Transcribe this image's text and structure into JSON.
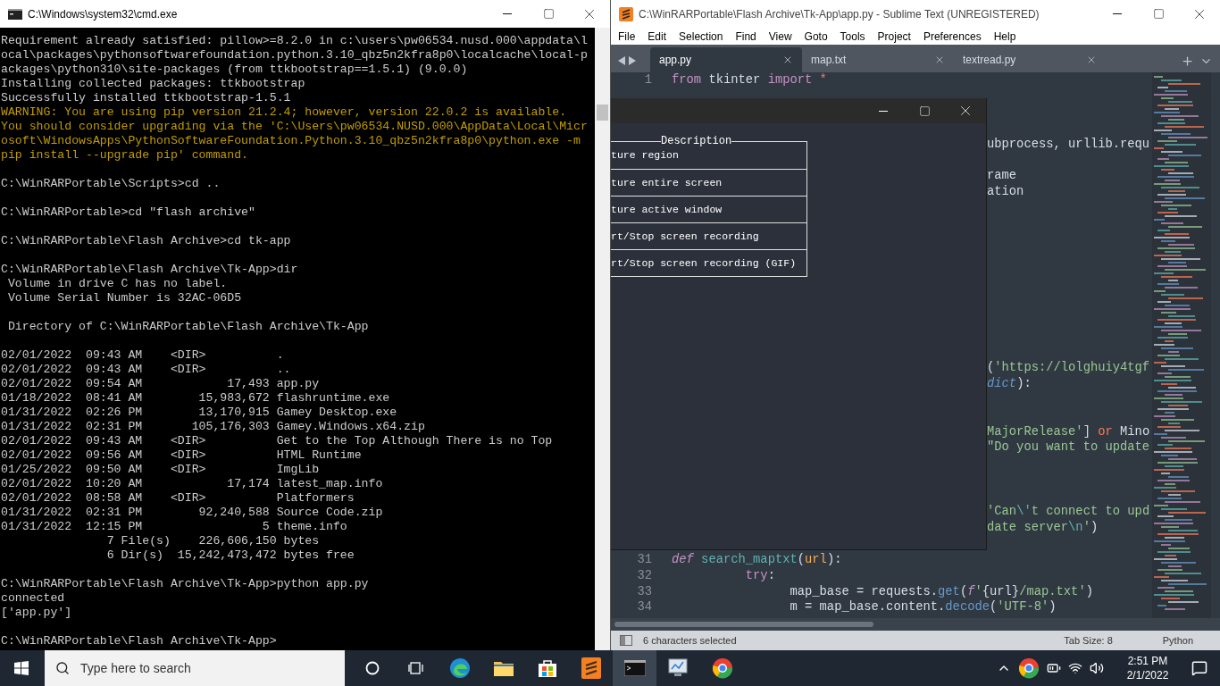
{
  "cmd_window": {
    "title": "C:\\Windows\\system32\\cmd.exe",
    "lines": [
      {
        "kind": "normal",
        "text": "Requirement already satisfied: pillow>=8.2.0 in c:\\users\\pw06534.nusd.000\\appdata\\l"
      },
      {
        "kind": "normal",
        "text": "ocal\\packages\\pythonsoftwarefoundation.python.3.10_qbz5n2kfra8p0\\localcache\\local-p"
      },
      {
        "kind": "normal",
        "text": "ackages\\python310\\site-packages (from ttkbootstrap==1.5.1) (9.0.0)"
      },
      {
        "kind": "normal",
        "text": "Installing collected packages: ttkbootstrap"
      },
      {
        "kind": "normal",
        "text": "Successfully installed ttkbootstrap-1.5.1"
      },
      {
        "kind": "warning",
        "text": "WARNING: You are using pip version 21.2.4; however, version 22.0.2 is available."
      },
      {
        "kind": "warning",
        "text": "You should consider upgrading via the 'C:\\Users\\pw06534.NUSD.000\\AppData\\Local\\Micr"
      },
      {
        "kind": "warning",
        "text": "osoft\\WindowsApps\\PythonSoftwareFoundation.Python.3.10_qbz5n2kfra8p0\\python.exe -m"
      },
      {
        "kind": "warning",
        "text": "pip install --upgrade pip' command."
      },
      {
        "kind": "blank"
      },
      {
        "kind": "normal",
        "text": "C:\\WinRARPortable\\Scripts>cd .."
      },
      {
        "kind": "blank"
      },
      {
        "kind": "normal",
        "text": "C:\\WinRARPortable>cd \"flash archive\""
      },
      {
        "kind": "blank"
      },
      {
        "kind": "normal",
        "text": "C:\\WinRARPortable\\Flash Archive>cd tk-app"
      },
      {
        "kind": "blank"
      },
      {
        "kind": "normal",
        "text": "C:\\WinRARPortable\\Flash Archive\\Tk-App>dir"
      },
      {
        "kind": "normal",
        "text": " Volume in drive C has no label."
      },
      {
        "kind": "normal",
        "text": " Volume Serial Number is 32AC-06D5"
      },
      {
        "kind": "blank"
      },
      {
        "kind": "normal",
        "text": " Directory of C:\\WinRARPortable\\Flash Archive\\Tk-App"
      },
      {
        "kind": "blank"
      },
      {
        "kind": "normal",
        "text": "02/01/2022  09:43 AM    <DIR>          ."
      },
      {
        "kind": "normal",
        "text": "02/01/2022  09:43 AM    <DIR>          .."
      },
      {
        "kind": "normal",
        "text": "02/01/2022  09:54 AM            17,493 app.py"
      },
      {
        "kind": "normal",
        "text": "01/18/2022  08:41 AM        15,983,672 flashruntime.exe"
      },
      {
        "kind": "normal",
        "text": "01/31/2022  02:26 PM        13,170,915 Gamey Desktop.exe"
      },
      {
        "kind": "normal",
        "text": "01/31/2022  02:31 PM       105,176,303 Gamey.Windows.x64.zip"
      },
      {
        "kind": "normal",
        "text": "02/01/2022  09:43 AM    <DIR>          Get to the Top Although There is no Top"
      },
      {
        "kind": "normal",
        "text": "02/01/2022  09:56 AM    <DIR>          HTML Runtime"
      },
      {
        "kind": "normal",
        "text": "01/25/2022  09:50 AM    <DIR>          ImgLib"
      },
      {
        "kind": "normal",
        "text": "02/01/2022  10:20 AM            17,174 latest_map.info"
      },
      {
        "kind": "normal",
        "text": "02/01/2022  08:58 AM    <DIR>          Platformers"
      },
      {
        "kind": "normal",
        "text": "01/31/2022  02:31 PM        92,240,588 Source Code.zip"
      },
      {
        "kind": "normal",
        "text": "01/31/2022  12:15 PM                 5 theme.info"
      },
      {
        "kind": "normal",
        "text": "               7 File(s)    226,606,150 bytes"
      },
      {
        "kind": "normal",
        "text": "               6 Dir(s)  15,242,473,472 bytes free"
      },
      {
        "kind": "blank"
      },
      {
        "kind": "normal",
        "text": "C:\\WinRARPortable\\Flash Archive\\Tk-App>python app.py"
      },
      {
        "kind": "normal",
        "text": "connected"
      },
      {
        "kind": "normal",
        "text": "['app.py']"
      },
      {
        "kind": "blank"
      },
      {
        "kind": "normal",
        "text": "C:\\WinRARPortable\\Flash Archive\\Tk-App>"
      }
    ]
  },
  "sublime_window": {
    "title": "C:\\WinRARPortable\\Flash Archive\\Tk-App\\app.py - Sublime Text (UNREGISTERED)",
    "menu": [
      "File",
      "Edit",
      "Selection",
      "Find",
      "View",
      "Goto",
      "Tools",
      "Project",
      "Preferences",
      "Help"
    ],
    "tabs": [
      {
        "label": "app.py",
        "selected": true
      },
      {
        "label": "map.txt",
        "selected": false
      },
      {
        "label": "textread.py",
        "selected": false
      }
    ],
    "lines": [
      {
        "kind": "line",
        "number": "1",
        "tokens": [
          {
            "kind": "keyword",
            "text": "from"
          },
          {
            "kind": "plain",
            "text": " tkinter "
          },
          {
            "kind": "keyword",
            "text": "import"
          },
          {
            "kind": "operator",
            "text": " *"
          }
        ]
      },
      {
        "kind": "covered"
      },
      {
        "kind": "covered"
      },
      {
        "kind": "covered"
      },
      {
        "kind": "fragment",
        "tokens": [
          {
            "kind": "plain",
            "text": "ubprocess, urllib.requ"
          }
        ]
      },
      {
        "kind": "covered"
      },
      {
        "kind": "fragment",
        "tokens": [
          {
            "kind": "plain",
            "text": "rame"
          }
        ]
      },
      {
        "kind": "fragment",
        "tokens": [
          {
            "kind": "plain",
            "text": "ation"
          }
        ]
      },
      {
        "kind": "covered"
      },
      {
        "kind": "covered"
      },
      {
        "kind": "covered"
      },
      {
        "kind": "covered"
      },
      {
        "kind": "covered"
      },
      {
        "kind": "covered"
      },
      {
        "kind": "covered"
      },
      {
        "kind": "covered"
      },
      {
        "kind": "covered"
      },
      {
        "kind": "covered"
      },
      {
        "kind": "fragment",
        "tokens": [
          {
            "kind": "plain",
            "text": "("
          },
          {
            "kind": "string",
            "text": "'https://lolghuiy4tgf"
          }
        ]
      },
      {
        "kind": "fragment",
        "tokens": [
          {
            "kind": "type",
            "text": "dict"
          },
          {
            "kind": "plain",
            "text": "):"
          }
        ]
      },
      {
        "kind": "covered"
      },
      {
        "kind": "covered"
      },
      {
        "kind": "fragment",
        "tokens": [
          {
            "kind": "string",
            "text": "MajorRelease'"
          },
          {
            "kind": "plain",
            "text": "] "
          },
          {
            "kind": "operator",
            "text": "or"
          },
          {
            "kind": "plain",
            "text": " Mino"
          }
        ]
      },
      {
        "kind": "fragment",
        "tokens": [
          {
            "kind": "string",
            "text": "\"Do you want to update"
          }
        ]
      },
      {
        "kind": "covered"
      },
      {
        "kind": "covered"
      },
      {
        "kind": "covered"
      },
      {
        "kind": "fragment",
        "tokens": [
          {
            "kind": "string",
            "text": "'Can"
          },
          {
            "kind": "escape",
            "text": "\\'"
          },
          {
            "kind": "string",
            "text": "t connect to upd"
          }
        ]
      },
      {
        "kind": "fragment",
        "tokens": [
          {
            "kind": "string",
            "text": "date server"
          },
          {
            "kind": "escape",
            "text": "\\n"
          },
          {
            "kind": "string",
            "text": "'"
          },
          {
            "kind": "plain",
            "text": ")"
          }
        ]
      },
      {
        "kind": "covered"
      },
      {
        "kind": "line",
        "number": "31",
        "tokens": [
          {
            "kind": "storage",
            "text": "def"
          },
          {
            "kind": "function",
            "text": " search_maptxt"
          },
          {
            "kind": "plain",
            "text": "("
          },
          {
            "kind": "param",
            "text": "url"
          },
          {
            "kind": "plain",
            "text": "):"
          }
        ]
      },
      {
        "kind": "line",
        "number": "32",
        "tokens": [
          {
            "kind": "keyword",
            "text": "          try"
          },
          {
            "kind": "plain",
            "text": ":"
          }
        ]
      },
      {
        "kind": "line",
        "number": "33",
        "tokens": [
          {
            "kind": "plain",
            "text": "                map_base = requests."
          },
          {
            "kind": "method",
            "text": "get"
          },
          {
            "kind": "plain",
            "text": "("
          },
          {
            "kind": "storage",
            "text": "f"
          },
          {
            "kind": "string",
            "text": "'"
          },
          {
            "kind": "plain",
            "text": "{url}"
          },
          {
            "kind": "string",
            "text": "/map.txt'"
          },
          {
            "kind": "plain",
            "text": ")"
          }
        ]
      },
      {
        "kind": "line",
        "number": "34",
        "tokens": [
          {
            "kind": "plain",
            "text": "                m = map_base.content."
          },
          {
            "kind": "method",
            "text": "decode"
          },
          {
            "kind": "plain",
            "text": "("
          },
          {
            "kind": "string",
            "text": "'UTF-8'"
          },
          {
            "kind": "plain",
            "text": ")"
          }
        ]
      }
    ],
    "status_bar": {
      "selection": "6 characters selected",
      "tab_size": "Tab Size: 8",
      "syntax": "Python"
    }
  },
  "tk_window": {
    "frame_title": "Description",
    "rows": [
      "ture region",
      "ture entire screen",
      "ture active window",
      "rt/Stop screen recording",
      "rt/Stop screen recording (GIF)"
    ]
  },
  "taskbar": {
    "search": {
      "placeholder": "Type here to search"
    },
    "apps": [
      {
        "kind": "cortana",
        "selected": false
      },
      {
        "kind": "task-view",
        "selected": false
      },
      {
        "kind": "edge",
        "selected": false
      },
      {
        "kind": "explorer",
        "selected": false
      },
      {
        "kind": "store",
        "selected": false
      },
      {
        "kind": "sublime",
        "selected": false
      },
      {
        "kind": "terminal",
        "selected": true
      },
      {
        "kind": "monitor",
        "selected": false
      },
      {
        "kind": "chrome",
        "selected": false
      }
    ],
    "time": "2:51 PM",
    "date": "2/1/2022"
  }
}
